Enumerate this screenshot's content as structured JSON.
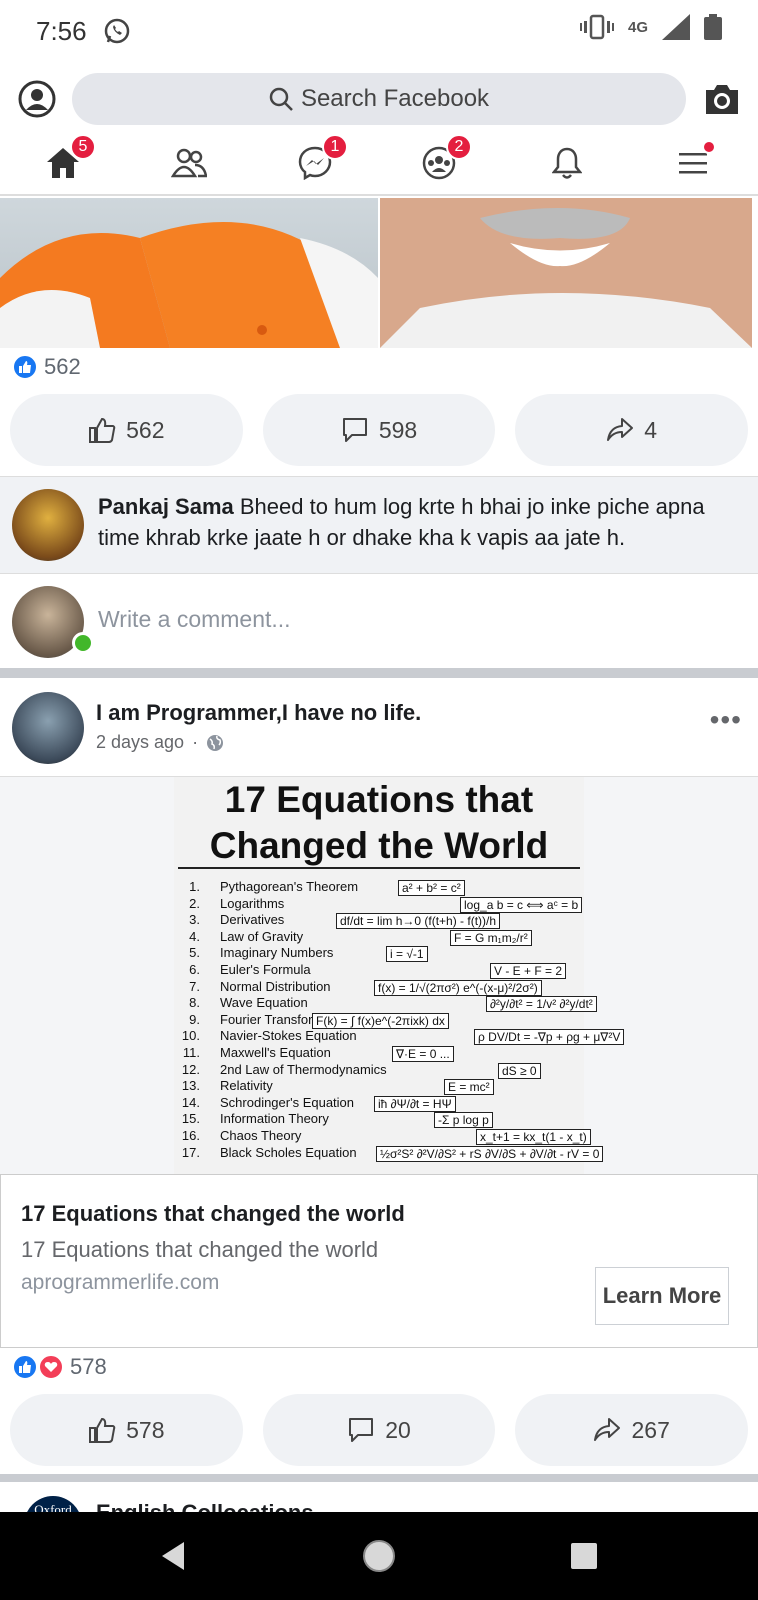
{
  "status_bar": {
    "time": "7:56",
    "network": "4G"
  },
  "top_bar": {
    "search_placeholder": "Search Facebook"
  },
  "nav": {
    "home_badge": "5",
    "messenger_badge": "1",
    "groups_badge": "2"
  },
  "post1": {
    "reaction_count": "562",
    "like_count": "562",
    "comment_count": "598",
    "share_count": "4",
    "top_comment": {
      "author": "Pankaj Sama",
      "text": " Bheed to hum log krte h bhai jo inke piche apna time khrab krke jaate h or dhake kha k vapis aa jate h."
    },
    "write_comment_placeholder": "Write a comment..."
  },
  "post2": {
    "page_name": "I am Programmer,I have no life.",
    "time": "2 days ago",
    "image": {
      "title_line1": "17 Equations that",
      "title_line2": "Changed the World",
      "items": [
        {
          "num": "1.",
          "label": "Pythagorean's Theorem",
          "formula": "a² + b² = c²"
        },
        {
          "num": "2.",
          "label": "Logarithms",
          "formula": "log_a b = c ⟺ aᶜ = b"
        },
        {
          "num": "3.",
          "label": "Derivatives",
          "formula": "df/dt = lim h→0 (f(t+h) - f(t))/h"
        },
        {
          "num": "4.",
          "label": "Law of Gravity",
          "formula": "F = G m₁m₂/r²"
        },
        {
          "num": "5.",
          "label": "Imaginary Numbers",
          "formula": "i = √-1"
        },
        {
          "num": "6.",
          "label": "Euler's Formula",
          "formula": "V - E + F = 2"
        },
        {
          "num": "7.",
          "label": "Normal Distribution",
          "formula": "f(x) = 1/√(2πσ²) e^(-(x-μ)²/2σ²)"
        },
        {
          "num": "8.",
          "label": "Wave Equation",
          "formula": "∂²y/∂t² = 1/v² ∂²y/dt²"
        },
        {
          "num": "9.",
          "label": "Fourier Transformation",
          "formula": "F(k) = ∫ f(x)e^(-2πixk) dx"
        },
        {
          "num": "10.",
          "label": "Navier-Stokes Equation",
          "formula": "ρ DV/Dt = -∇p + ρg + μ∇²V"
        },
        {
          "num": "11.",
          "label": "Maxwell's Equation",
          "formula": "∇·E = 0 ..."
        },
        {
          "num": "12.",
          "label": "2nd Law of Thermodynamics",
          "formula": "dS ≥ 0"
        },
        {
          "num": "13.",
          "label": "Relativity",
          "formula": "E = mc²"
        },
        {
          "num": "14.",
          "label": "Schrodinger's Equation",
          "formula": "iħ ∂Ψ/∂t = HΨ"
        },
        {
          "num": "15.",
          "label": "Information Theory",
          "formula": "-Σ p log p"
        },
        {
          "num": "16.",
          "label": "Chaos Theory",
          "formula": "x_t+1 = kx_t(1 - x_t)"
        },
        {
          "num": "17.",
          "label": "Black Scholes Equation",
          "formula": "½σ²S² ∂²V/∂S² + rS ∂V/∂S + ∂V/∂t - rV = 0"
        }
      ]
    },
    "link": {
      "title": "17 Equations that changed the world",
      "description": "17 Equations that changed the world",
      "domain": "aprogrammerlife.com",
      "cta": "Learn More"
    },
    "reaction_count": "578",
    "like_count": "578",
    "comment_count": "20",
    "share_count": "267"
  },
  "next_post": {
    "avatar_text": "Oxford",
    "name": "English Collocations"
  },
  "colors": {
    "facebook_blue": "#1877f2",
    "badge_red": "#e41e3f",
    "love_red": "#f33e58",
    "online_green": "#42b72a"
  }
}
